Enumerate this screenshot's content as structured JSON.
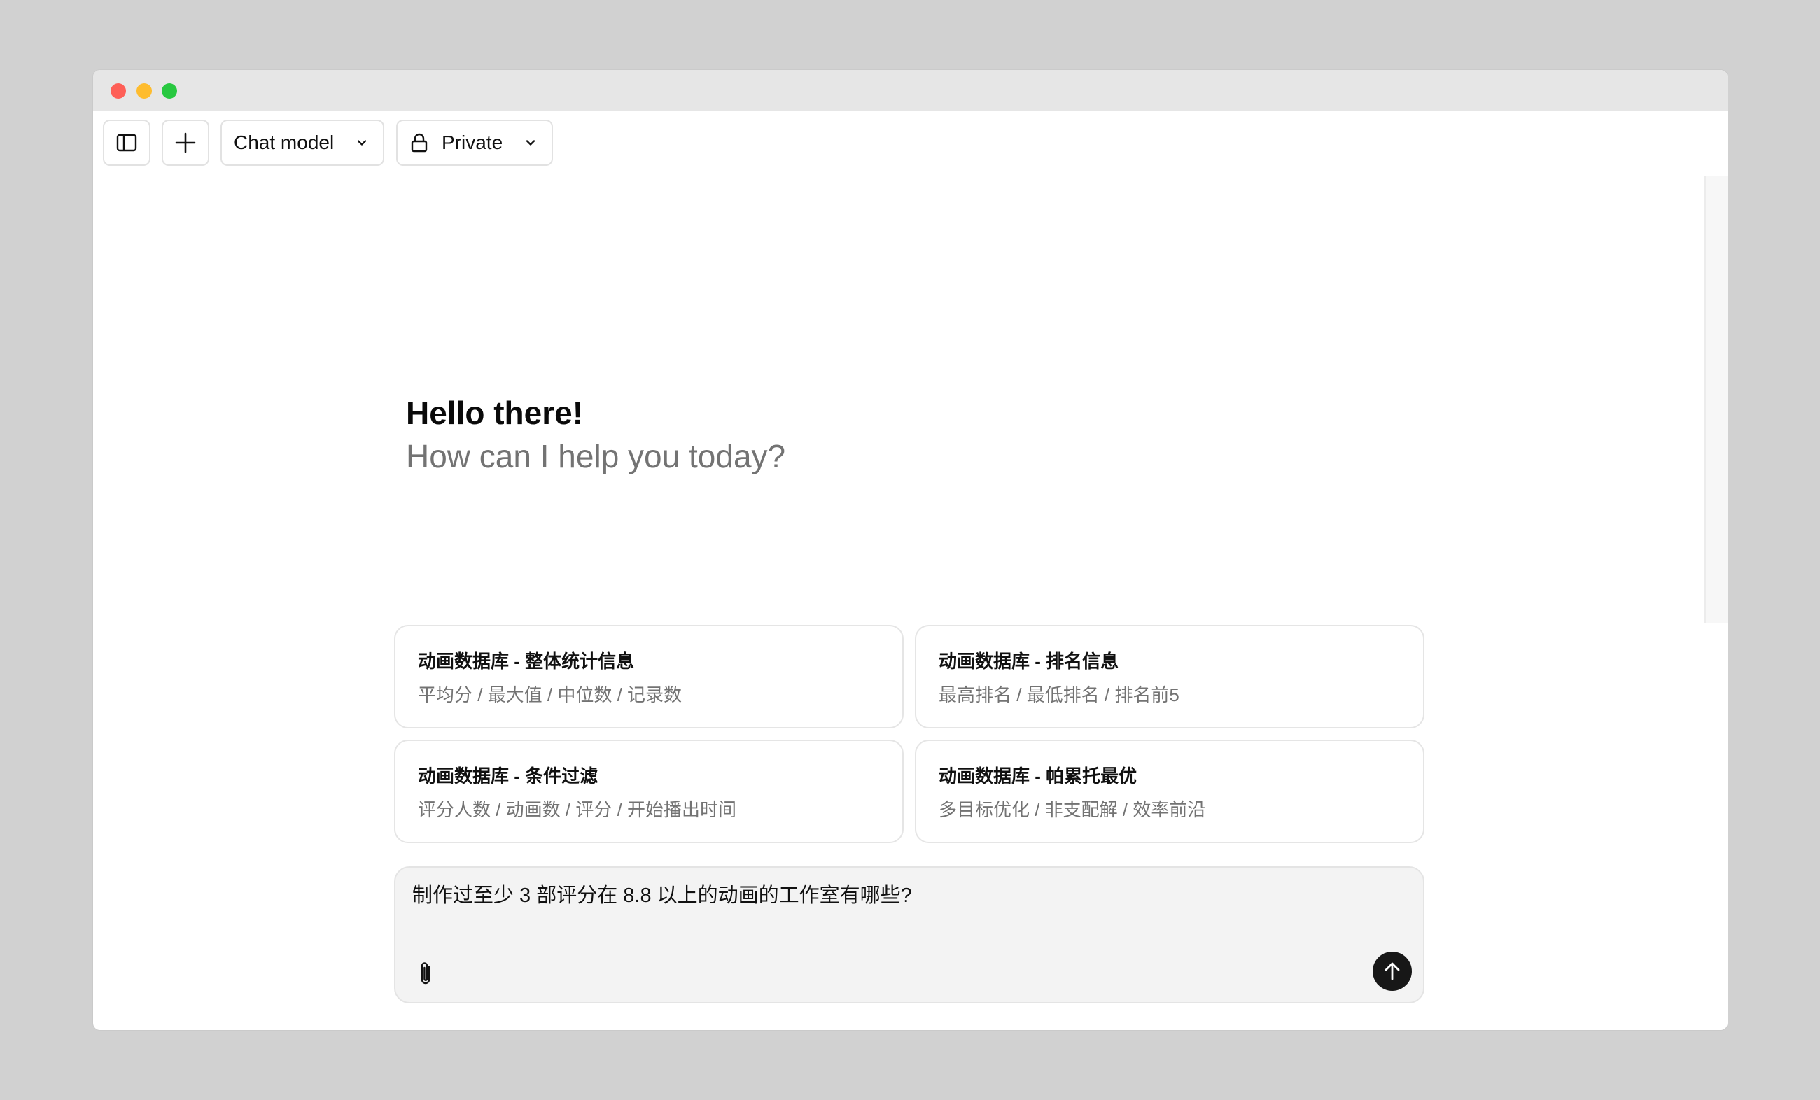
{
  "toolbar": {
    "model_label": "Chat model",
    "visibility_label": "Private",
    "icons": {
      "sidebar": "sidebar-toggle-icon",
      "new_chat": "plus-icon",
      "chevron": "chevron-down-icon",
      "lock": "lock-icon"
    }
  },
  "greeting": {
    "title": "Hello there!",
    "subtitle": "How can I help you today?"
  },
  "suggestions": [
    {
      "title": "动画数据库 - 整体统计信息",
      "description": "平均分 / 最大值 / 中位数 / 记录数"
    },
    {
      "title": "动画数据库 - 排名信息",
      "description": "最高排名 / 最低排名 / 排名前5"
    },
    {
      "title": "动画数据库 - 条件过滤",
      "description": "评分人数 / 动画数 / 评分 / 开始播出时间"
    },
    {
      "title": "动画数据库 - 帕累托最优",
      "description": "多目标优化 / 非支配解 / 效率前沿"
    }
  ],
  "composer": {
    "value": "制作过至少 3 部评分在 8.8 以上的动画的工作室有哪些?",
    "attach_icon": "paperclip-icon",
    "send_icon": "arrow-up-icon"
  },
  "colors": {
    "background": "#d1d1d1",
    "titlebar": "#e6e6e6",
    "close": "#fe5f57",
    "minimize": "#febc2e",
    "maximize": "#28c840",
    "muted_text": "#737373",
    "composer_bg": "#f3f3f3",
    "send_button": "#171717"
  }
}
